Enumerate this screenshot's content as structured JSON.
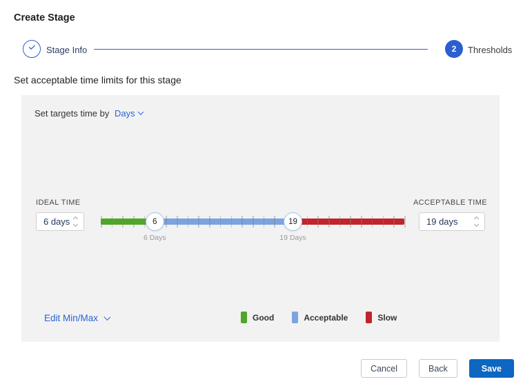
{
  "title": "Create Stage",
  "subtitle": "Set acceptable time limits for this stage",
  "stepper": {
    "step1_label": "Stage Info",
    "step2_number": "2",
    "step2_label": "Thresholds"
  },
  "panel": {
    "target_prefix": "Set targets time by",
    "target_unit": "Days",
    "ideal_label": "IDEAL TIME",
    "ideal_value": "6 days",
    "acceptable_label": "ACCEPTABLE TIME",
    "acceptable_value": "19 days",
    "edit_minmax_label": "Edit Min/Max"
  },
  "slider": {
    "unit": "Days",
    "tick_count": 29,
    "handles": [
      {
        "value": "6",
        "label": "6 Days",
        "percent": 17.8
      },
      {
        "value": "19",
        "label": "19 Days",
        "percent": 63.3
      }
    ],
    "segments": [
      {
        "name": "Good",
        "color": "#4fa627"
      },
      {
        "name": "Acceptable",
        "color": "#7aa4e2"
      },
      {
        "name": "Slow",
        "color": "#c1242b"
      }
    ]
  },
  "legend": [
    {
      "label": "Good",
      "color": "#4fa627"
    },
    {
      "label": "Acceptable",
      "color": "#7aa4e2"
    },
    {
      "label": "Slow",
      "color": "#c1242b"
    }
  ],
  "buttons": {
    "cancel": "Cancel",
    "back": "Back",
    "save": "Save"
  },
  "colors": {
    "accent_blue": "#2c5ed2",
    "link_blue": "#2a63d4",
    "save_blue": "#0d66c2",
    "panel_bg": "#f2f2f2"
  }
}
